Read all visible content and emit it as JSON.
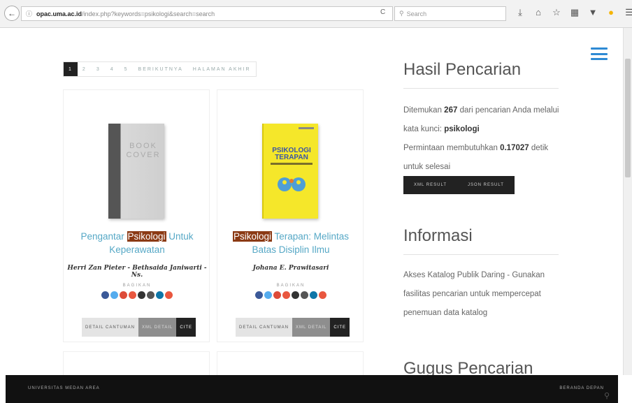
{
  "browser": {
    "url_domain": "opac.uma.ac.id",
    "url_rest": "/index.php?keywords=psikologi&search=search",
    "search_placeholder": "Search",
    "reload_icon": "C"
  },
  "pagination": {
    "pages": [
      "1",
      "2",
      "3",
      "4",
      "5"
    ],
    "next": "BERIKUTNYA",
    "last": "HALAMAN AKHIR"
  },
  "cards": [
    {
      "cover_text": "BOOK COVER",
      "title_before": "Pengantar ",
      "title_highlight": "Psikologi",
      "title_after": " Untuk Keperawatan",
      "author": "Herri Zan Pieter - Bethsaida Janiwarti - Ns.",
      "share_label": "BAGIKAN",
      "btn_detail": "DETAIL CANTUMAN",
      "btn_xml": "XML DETAIL",
      "btn_cite": "CITE"
    },
    {
      "cover_title": "PSIKOLOGI TERAPAN",
      "title_before": "",
      "title_highlight": "Psikologi",
      "title_after": " Terapan: Melintas Batas Disiplin Ilmu",
      "author": "Johana E. Prawitasari",
      "share_label": "BAGIKAN",
      "btn_detail": "DETAIL CANTUMAN",
      "btn_xml": "XML DETAIL",
      "btn_cite": "CITE"
    }
  ],
  "share_colors": [
    "#3b5998",
    "#55acee",
    "#dd4b39",
    "#e9573f",
    "#333333",
    "#555555",
    "#0e76a8",
    "#e9573f"
  ],
  "results": {
    "heading": "Hasil Pencarian",
    "text_1": "Ditemukan",
    "count": "267",
    "text_2": "dari pencarian Anda melalui kata kunci:",
    "keyword": "psikologi",
    "text_3": "Permintaan membutuhkan",
    "time": "0.17027",
    "text_4": "detik untuk selesai",
    "xml_result": "XML RESULT",
    "json_result": "JSON RESULT"
  },
  "info": {
    "heading": "Informasi",
    "text": "Akses Katalog Publik Daring - Gunakan fasilitas pencarian untuk mempercepat penemuan data katalog"
  },
  "gugus": {
    "heading": "Gugus Pencarian"
  },
  "footer": {
    "left": "UNIVERSITAS MEDAN AREA",
    "right": "BERANDA DEPAN"
  }
}
